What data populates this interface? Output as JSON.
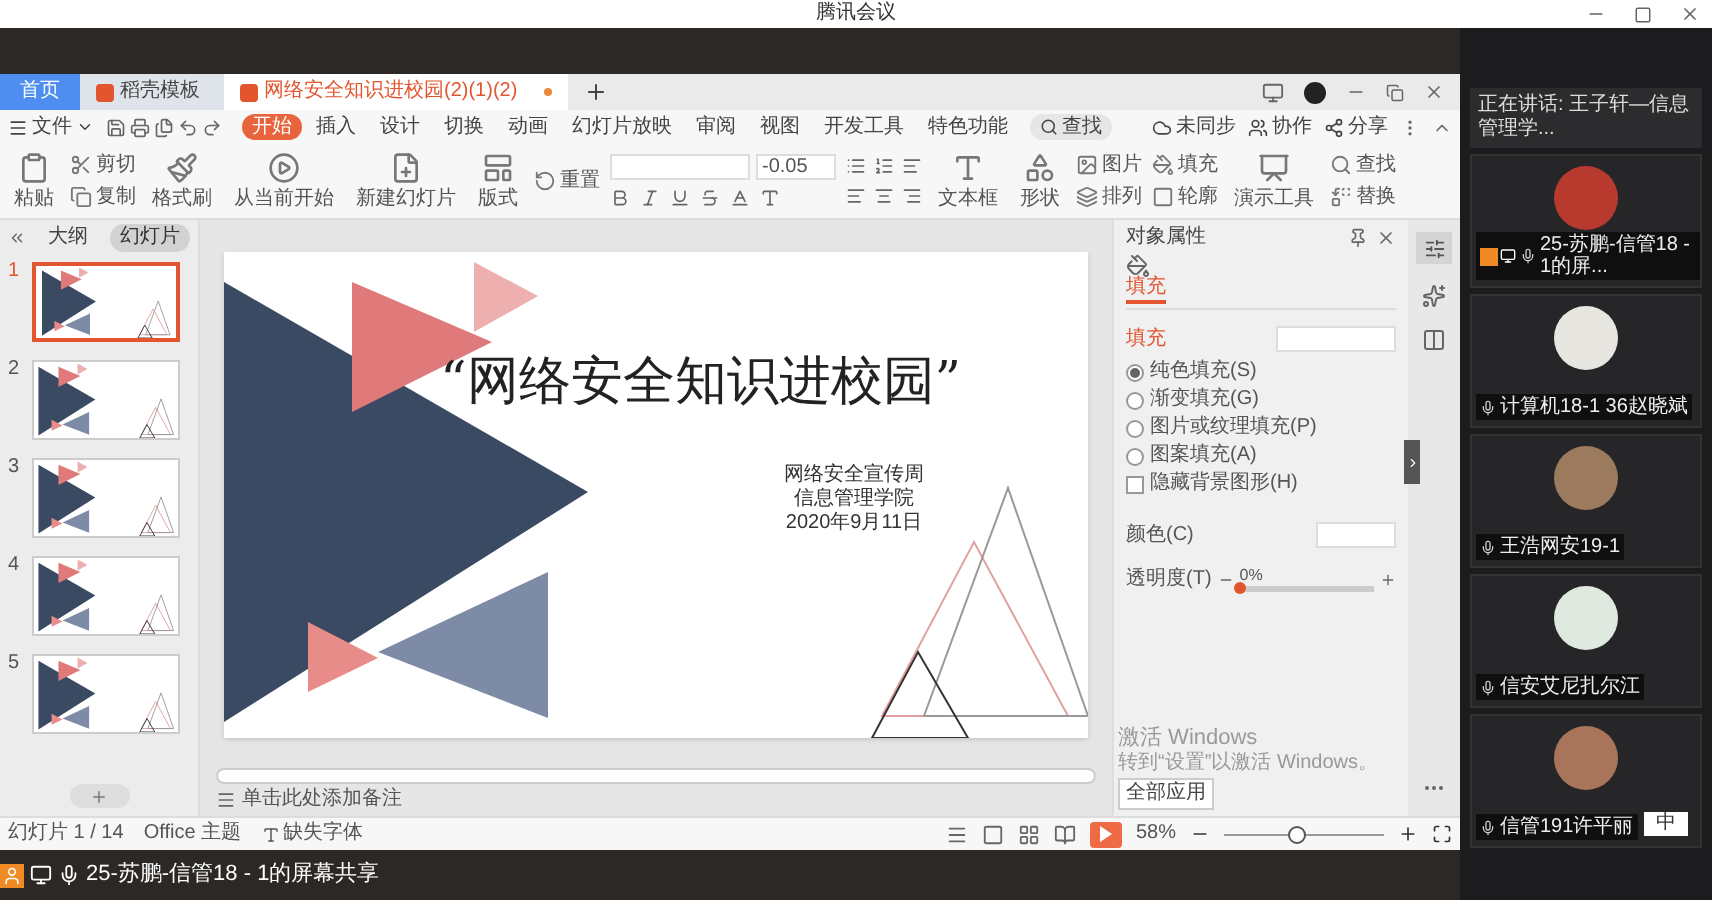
{
  "meeting_title": "腾讯会议",
  "wps_tabs": [
    {
      "label": "首页",
      "kind": "home",
      "selected": false
    },
    {
      "label": "稻壳模板",
      "kind": "template",
      "selected": false
    },
    {
      "label": "网络安全知识进校园(2)(1)(2)",
      "kind": "document",
      "selected": true
    }
  ],
  "file_menu": "文件",
  "ribbon_tabs": [
    {
      "label": "开始",
      "selected": true
    },
    {
      "label": "插入",
      "selected": false
    },
    {
      "label": "设计",
      "selected": false
    },
    {
      "label": "切换",
      "selected": false
    },
    {
      "label": "动画",
      "selected": false
    },
    {
      "label": "幻灯片放映",
      "selected": false
    },
    {
      "label": "审阅",
      "selected": false
    },
    {
      "label": "视图",
      "selected": false
    },
    {
      "label": "开发工具",
      "selected": false
    },
    {
      "label": "特色功能",
      "selected": false
    }
  ],
  "search_label": "查找",
  "cloud_actions": [
    {
      "label": "未同步",
      "kind": "sync"
    },
    {
      "label": "协作",
      "kind": "collab"
    },
    {
      "label": "分享",
      "kind": "share"
    }
  ],
  "toolbar": {
    "paste": "粘贴",
    "cut": "剪切",
    "copy": "复制",
    "format_painter": "格式刷",
    "play_from_current": "从当前开始",
    "new_slide": "新建幻灯片",
    "layout": "版式",
    "reset": "重置",
    "font_size": "-0.05",
    "text_box": "文本框",
    "shape": "形状",
    "picture": "图片",
    "fill": "填充",
    "arrange": "排列",
    "outline": "轮廓",
    "presentation_tools": "演示工具",
    "find": "查找",
    "replace": "替换"
  },
  "slide_panel": {
    "tabs": [
      {
        "label": "大纲",
        "selected": false
      },
      {
        "label": "幻灯片",
        "selected": true
      }
    ],
    "thumbnails": [
      {
        "number": "1",
        "selected": true
      },
      {
        "number": "2",
        "selected": false
      },
      {
        "number": "3",
        "selected": false
      },
      {
        "number": "4",
        "selected": false
      },
      {
        "number": "5",
        "selected": false
      }
    ]
  },
  "slide": {
    "title": "“网络安全知识进校园”",
    "subtitle_lines": [
      "网络安全宣传周",
      "信息管理学院",
      "2020年9月11日"
    ]
  },
  "notes_placeholder": "单击此处添加备注",
  "properties_panel": {
    "title": "对象属性",
    "tab": "填充",
    "section": "填充",
    "fill_options": [
      {
        "label": "纯色填充(S)",
        "selected": true
      },
      {
        "label": "渐变填充(G)",
        "selected": false
      },
      {
        "label": "图片或纹理填充(P)",
        "selected": false
      },
      {
        "label": "图案填充(A)",
        "selected": false
      }
    ],
    "hide_background": {
      "label": "隐藏背景图形(H)",
      "checked": false
    },
    "color_label": "颜色(C)",
    "transparency_label": "透明度(T)",
    "transparency": {
      "reading": "0%",
      "level": 0
    },
    "apply_all": "全部应用"
  },
  "activation_notice": [
    "激活 Windows",
    "转到“设置”以激活 Windows。"
  ],
  "status_bar": {
    "slide_counter": "幻灯片 1 / 14",
    "theme": "Office 主题",
    "missing_fonts": "缺失字体",
    "zoom": "58%",
    "zoom_slider": {
      "level": 0.45
    }
  },
  "screen_share_label": "25-苏鹏-信管18 - 1的屏幕共享",
  "meeting": {
    "speaking": "正在讲话: 王子轩—信息管理学...",
    "participants": [
      {
        "name": "25-苏鹏-信管18 - 1的屏...",
        "sharing": true
      },
      {
        "name": "计算机18-1 36赵晓斌",
        "sharing": false
      },
      {
        "name": "王浩网安19-1",
        "sharing": false
      },
      {
        "name": "信安艾尼扎尔江",
        "sharing": false
      },
      {
        "name": "信管191许平丽",
        "sharing": false
      }
    ]
  },
  "ime_label": "中"
}
